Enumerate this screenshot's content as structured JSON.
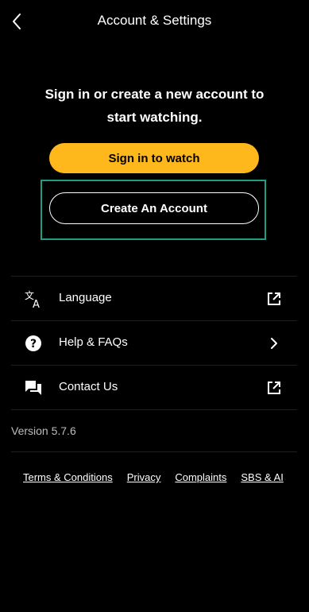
{
  "header": {
    "title": "Account & Settings",
    "back_icon": "chevron-left-icon"
  },
  "auth": {
    "prompt_line1": "Sign in or create a new account to",
    "prompt_line2": "start watching.",
    "signin_label": "Sign in to watch",
    "create_label": "Create An Account"
  },
  "menu": {
    "items": [
      {
        "label": "Language",
        "icon": "translate-icon",
        "trailing": "external-link-icon"
      },
      {
        "label": "Help & FAQs",
        "icon": "help-icon",
        "trailing": "chevron-right-icon"
      },
      {
        "label": "Contact Us",
        "icon": "chat-icon",
        "trailing": "external-link-icon"
      }
    ]
  },
  "version": "Version 5.7.6",
  "footer": {
    "links": [
      "Terms & Conditions",
      "Privacy",
      "Complaints",
      "SBS & AI"
    ]
  },
  "colors": {
    "background": "#000000",
    "accent": "#ffb81c",
    "focus": "#1f9e83",
    "text": "#ffffff"
  }
}
